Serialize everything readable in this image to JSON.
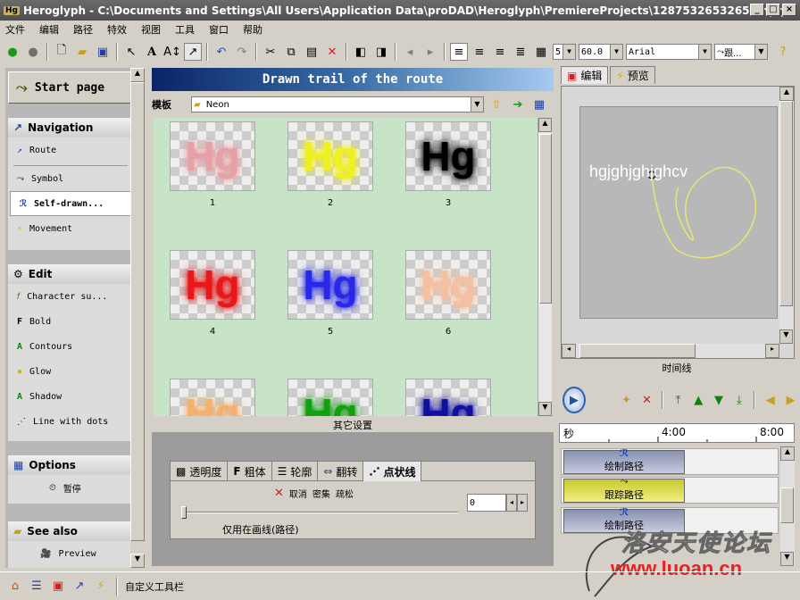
{
  "window": {
    "title": "Heroglyph - C:\\Documents and Settings\\All Users\\Application Data\\proDAD\\Heroglyph\\PremiereProjects\\12875326532656.hprj",
    "logo_text": "Hg"
  },
  "menu": [
    "文件",
    "编辑",
    "路径",
    "特效",
    "视图",
    "工具",
    "窗口",
    "帮助"
  ],
  "toolbar": {
    "line_width": "5",
    "size": "60.0",
    "font": "Arial",
    "mode": "跟..."
  },
  "left": {
    "start_page": "Start page",
    "navigation": {
      "title": "Navigation",
      "items": [
        "Route",
        "Symbol",
        "Self-drawn...",
        "Movement"
      ]
    },
    "edit": {
      "title": "Edit",
      "items": [
        "Character su...",
        "Bold",
        "Contours",
        "Glow",
        "Shadow",
        "Line with dots"
      ]
    },
    "options": {
      "title": "Options",
      "items": [
        "暂停"
      ]
    },
    "see_also": {
      "title": "See also",
      "items": [
        "Preview"
      ]
    }
  },
  "center": {
    "header": "Drawn trail of the route",
    "template_label": "模板",
    "template_value": "Neon",
    "thumbs": [
      {
        "label": "1",
        "glyph": "Hg",
        "color": "#e8a0a8"
      },
      {
        "label": "2",
        "glyph": "Hg",
        "color": "#f0f020"
      },
      {
        "label": "3",
        "glyph": "Hg",
        "color": "#000000"
      },
      {
        "label": "4",
        "glyph": "Hg",
        "color": "#e81818"
      },
      {
        "label": "5",
        "glyph": "Hg",
        "color": "#2828e8"
      },
      {
        "label": "6",
        "glyph": "Hg",
        "color": "#f4c0a0"
      },
      {
        "label": "",
        "glyph": "Hg",
        "color": "#f4b070"
      },
      {
        "label": "",
        "glyph": "Hg",
        "color": "#10a010"
      },
      {
        "label": "",
        "glyph": "Hg",
        "color": "#1010a0"
      }
    ],
    "other_settings": "其它设置",
    "tabs": [
      "透明度",
      "粗体",
      "轮廓",
      "翻转",
      "点状线"
    ],
    "actions": {
      "cancel": "取消",
      "sparse": "密集",
      "loose": "疏松"
    },
    "slider_value": "0",
    "note": "仅用在画线(路径)"
  },
  "right": {
    "tabs": [
      "编辑",
      "预览"
    ],
    "preview_text": "hgjghjghjghcv",
    "timeline_label": "时间线",
    "ruler": {
      "unit": "秒",
      "t1": "4:00",
      "t2": "8:00"
    },
    "tracks": [
      "绘制路径",
      "跟踪路径",
      "绘制路径"
    ]
  },
  "status": {
    "text": "自定义工具栏"
  },
  "watermark": {
    "line1": "洛安天使论坛",
    "line2": "www.luoan.cn"
  }
}
